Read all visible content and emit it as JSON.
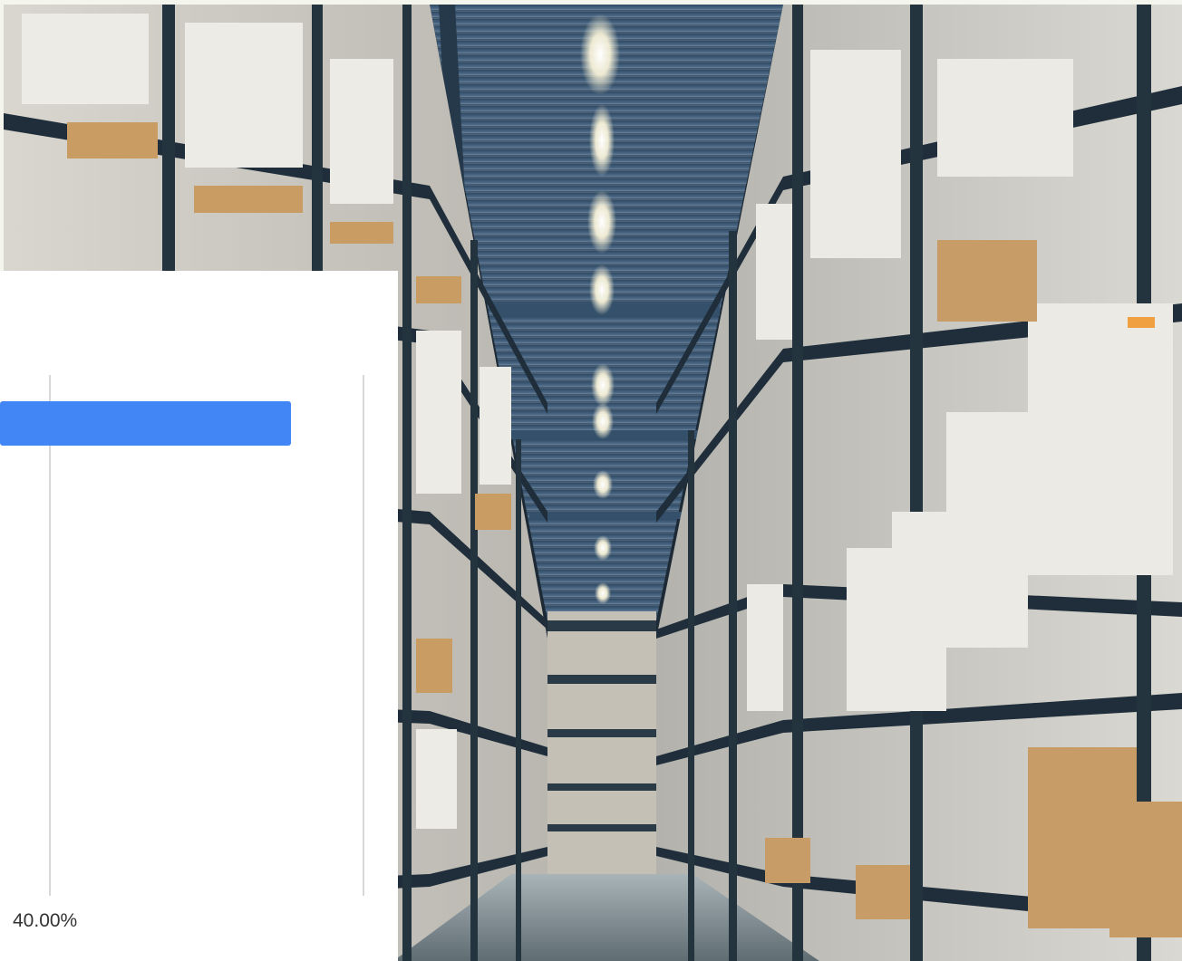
{
  "background_image": {
    "subject": "warehouse-aisle-photo",
    "colors": {
      "ceiling": "#3f5870",
      "shelving": "#20303c",
      "boxes": "#e6e2d8",
      "cardboard": "#c79a62",
      "lights": "#fffbe8",
      "floor": "#7f8c92"
    }
  },
  "chart_data": {
    "type": "bar",
    "orientation": "horizontal",
    "series": [
      {
        "values": [
          40.0
        ],
        "color": "#4285f4"
      }
    ],
    "x_ticks": [
      "40.00%"
    ],
    "grid": true
  }
}
